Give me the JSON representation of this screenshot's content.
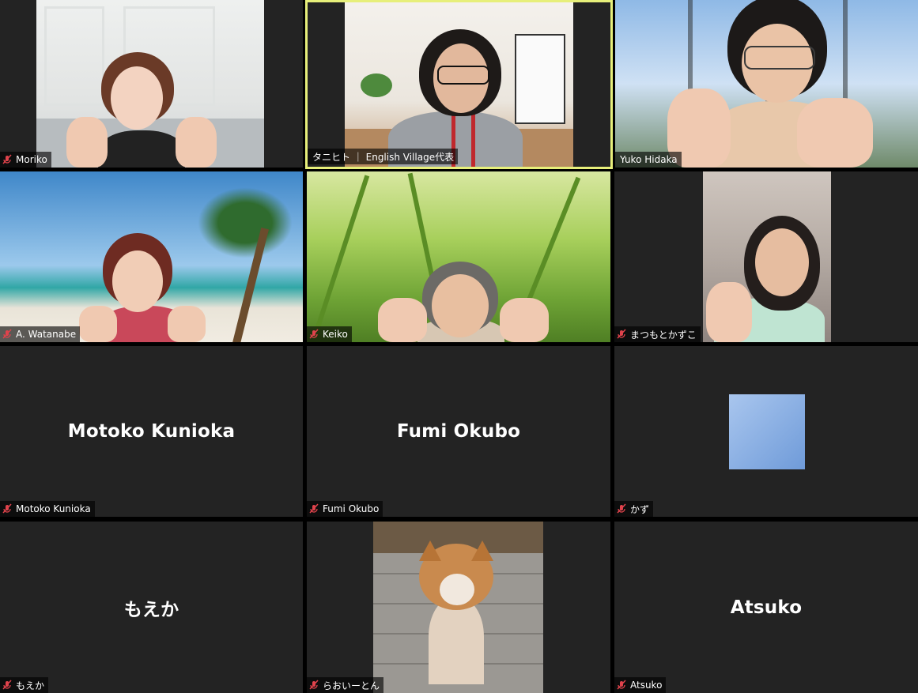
{
  "participants": [
    {
      "id": "moriko",
      "label": "Moriko",
      "display_name": "",
      "muted": true,
      "video": true
    },
    {
      "id": "tanihito",
      "label": "タニヒト ｜ English Village代表",
      "display_name": "",
      "muted": false,
      "video": true,
      "active_speaker": true
    },
    {
      "id": "yuko",
      "label": "Yuko Hidaka",
      "display_name": "",
      "muted": false,
      "video": true
    },
    {
      "id": "watanabe",
      "label": "A. Watanabe",
      "display_name": "",
      "muted": true,
      "video": true
    },
    {
      "id": "keiko",
      "label": "Keiko",
      "display_name": "",
      "muted": true,
      "video": true
    },
    {
      "id": "matsumoto",
      "label": "まつもとかずこ",
      "display_name": "",
      "muted": true,
      "video": true
    },
    {
      "id": "motoko",
      "label": "Motoko Kunioka",
      "display_name": "Motoko Kunioka",
      "muted": true,
      "video": false
    },
    {
      "id": "fumi",
      "label": "Fumi Okubo",
      "display_name": "Fumi Okubo",
      "muted": true,
      "video": false
    },
    {
      "id": "kazu",
      "label": "かず",
      "display_name": "",
      "muted": true,
      "video": false,
      "avatar": "profile-picture"
    },
    {
      "id": "moeka",
      "label": "もえか",
      "display_name": "もえか",
      "muted": true,
      "video": false
    },
    {
      "id": "raoi",
      "label": "らおいーとん",
      "display_name": "",
      "muted": true,
      "video": true
    },
    {
      "id": "atsuko",
      "label": "Atsuko",
      "display_name": "Atsuko",
      "muted": true,
      "video": false
    }
  ],
  "colors": {
    "tile_bg": "#232323",
    "active_border": "#e7ef7a",
    "muted_icon": "#e0434c",
    "label_text": "#ffffff"
  },
  "icons": {
    "muted": "mic-muted-icon"
  }
}
